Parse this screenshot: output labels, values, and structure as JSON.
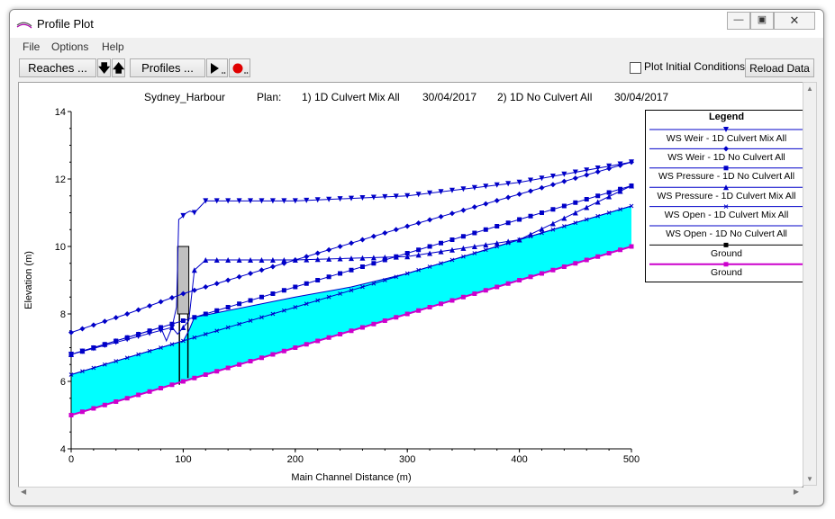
{
  "window": {
    "title": "Profile Plot"
  },
  "menu": [
    "File",
    "Options",
    "Help"
  ],
  "toolbar": {
    "reaches_label": "Reaches ...",
    "profiles_label": "Profiles ...",
    "plot_initial_label": "Plot Initial Conditions",
    "plot_initial_checked": false,
    "reload_label": "Reload Data"
  },
  "plot_header": {
    "river": "Sydney_Harbour",
    "plan_label": "Plan:",
    "plan1": "1) 1D Culvert Mix All",
    "date1": "30/04/2017",
    "plan2": "2) 1D No Culvert All",
    "date2": "30/04/2017"
  },
  "legend": {
    "title": "Legend",
    "items": [
      {
        "label": "WS  Weir - 1D Culvert Mix All",
        "marker": "triangle-down",
        "color": "#0000c8"
      },
      {
        "label": "WS  Weir - 1D No Culvert All",
        "marker": "diamond",
        "color": "#0000c8"
      },
      {
        "label": "WS  Pressure - 1D No Culvert All",
        "marker": "square",
        "color": "#0000c8"
      },
      {
        "label": "WS  Pressure - 1D Culvert Mix All",
        "marker": "triangle-up",
        "color": "#0000c8"
      },
      {
        "label": "WS  Open - 1D Culvert Mix All",
        "marker": "x",
        "color": "#0000c8"
      },
      {
        "label": "WS  Open - 1D No Culvert All",
        "marker": "none",
        "color": "#0000c8"
      },
      {
        "label": "Ground",
        "marker": "square",
        "color": "#000000"
      },
      {
        "label": "Ground",
        "marker": "square",
        "color": "#cc00cc"
      }
    ]
  },
  "chart_data": {
    "type": "line",
    "xlabel": "Main Channel Distance (m)",
    "ylabel": "Elevation (m)",
    "xlim": [
      0,
      500
    ],
    "ylim": [
      4,
      14
    ],
    "x_ticks": [
      "0",
      "100",
      "200",
      "300",
      "400",
      "500"
    ],
    "y_ticks": [
      "4",
      "6",
      "8",
      "10",
      "12",
      "14"
    ],
    "series": [
      {
        "name": "WS  Weir - 1D Culvert Mix All",
        "color": "#0000c8",
        "marker": "triangle-down",
        "x": [
          0,
          90,
          94,
          96,
          98,
          103,
          106,
          110,
          120,
          200,
          300,
          400,
          500
        ],
        "y": [
          6.8,
          7.6,
          8.2,
          10.8,
          10.85,
          11.0,
          11.05,
          11.0,
          11.35,
          11.35,
          11.5,
          11.9,
          12.5
        ]
      },
      {
        "name": "WS  Weir - 1D No Culvert All",
        "color": "#0000c8",
        "marker": "diamond",
        "x": [
          0,
          50,
          100,
          200,
          300,
          400,
          500
        ],
        "y": [
          7.45,
          8.0,
          8.6,
          9.6,
          10.6,
          11.55,
          12.5
        ]
      },
      {
        "name": "WS  Pressure - 1D No Culvert All",
        "color": "#0000c8",
        "marker": "square",
        "x": [
          0,
          50,
          100,
          200,
          300,
          400,
          500
        ],
        "y": [
          6.8,
          7.3,
          7.8,
          8.8,
          9.8,
          10.8,
          11.8
        ]
      },
      {
        "name": "WS  Pressure - 1D Culvert Mix All",
        "color": "#0000c8",
        "marker": "triangle-up",
        "x": [
          0,
          80,
          85,
          90,
          95,
          100,
          105,
          110,
          120,
          200,
          300,
          400,
          500
        ],
        "y": [
          6.8,
          7.6,
          7.2,
          7.6,
          7.4,
          7.6,
          7.8,
          9.3,
          9.6,
          9.6,
          9.7,
          10.2,
          11.8
        ]
      },
      {
        "name": "WS  Open - 1D Culvert Mix All",
        "color": "#0000c8",
        "marker": "x",
        "x": [
          0,
          100,
          200,
          300,
          400,
          500
        ],
        "y": [
          6.2,
          7.2,
          8.2,
          9.2,
          10.2,
          11.2
        ]
      },
      {
        "name": "WS  Open - 1D No Culvert All",
        "color": "#0000c8",
        "marker": "none",
        "x": [
          0,
          100,
          105,
          110,
          140,
          200,
          250,
          300,
          400,
          500
        ],
        "y": [
          6.2,
          7.2,
          7.5,
          7.9,
          8.1,
          8.5,
          8.8,
          9.2,
          10.2,
          11.2
        ]
      },
      {
        "name": "Ground",
        "color": "#cc00cc",
        "marker": "square",
        "x": [
          0,
          100,
          200,
          300,
          400,
          500
        ],
        "y": [
          5.0,
          6.0,
          7.0,
          8.0,
          9.0,
          10.0
        ]
      }
    ],
    "culvert": {
      "x_start": 95,
      "x_end": 105,
      "top": 10.0,
      "bottom": 5.9
    },
    "water_fill_color": "#00ffff"
  }
}
